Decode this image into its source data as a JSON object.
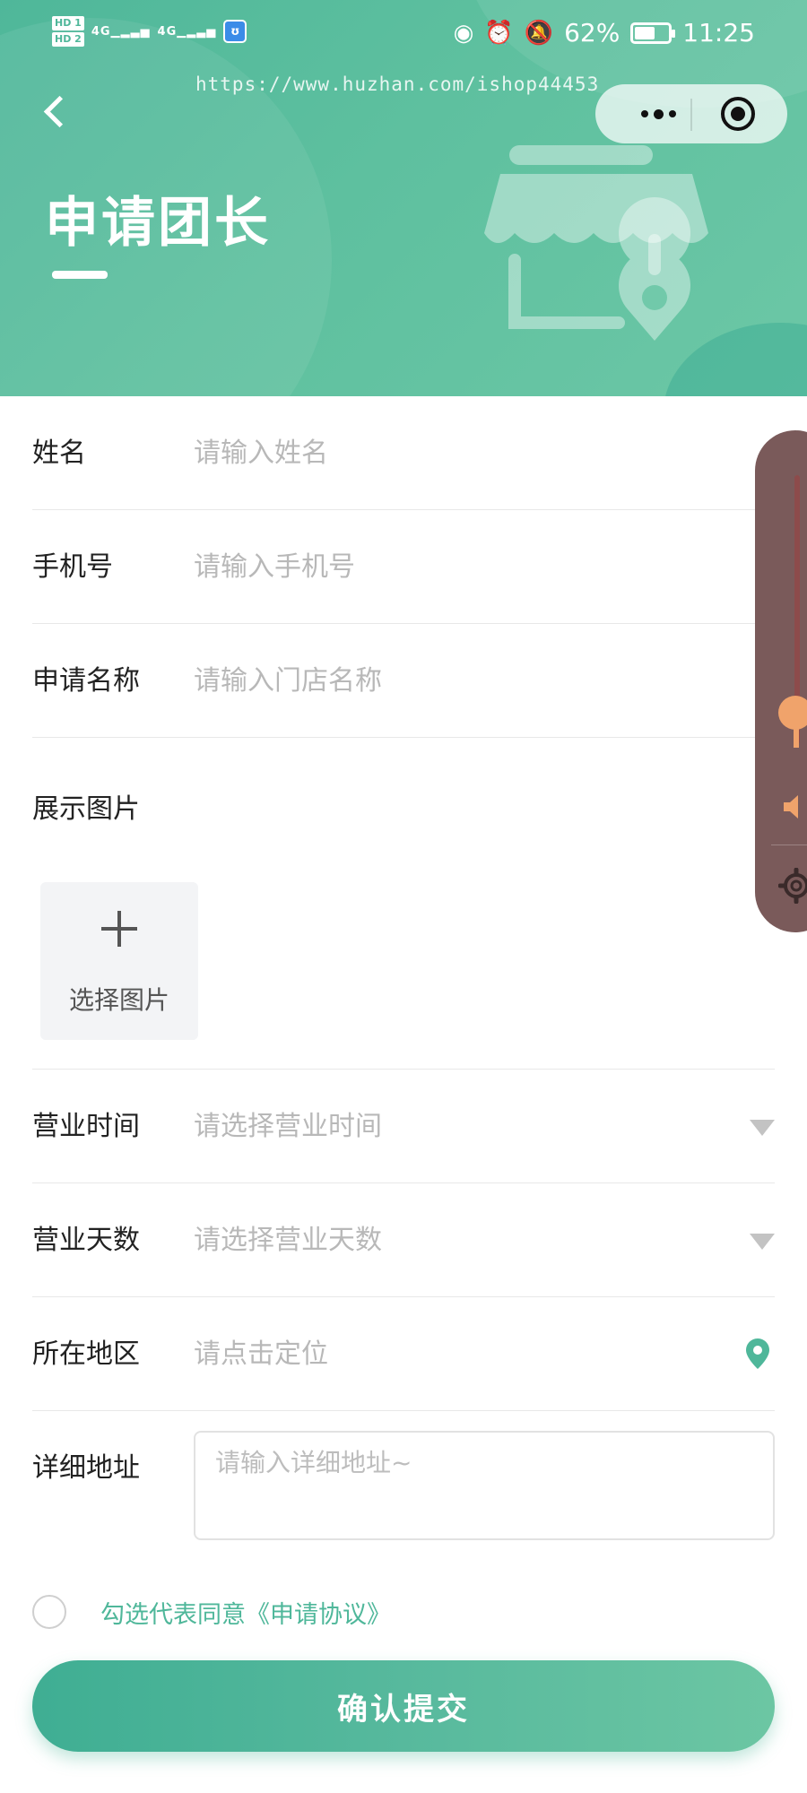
{
  "status_bar": {
    "hd1": "HD 1",
    "hd2": "HD 2",
    "network1": "4G",
    "network2": "4G",
    "app_badge": "ʊ",
    "battery_percent": "62%",
    "battery_level": 0.62,
    "time": "11:25"
  },
  "watermark": "https://www.huzhan.com/ishop44453",
  "header": {
    "title": "申请团长"
  },
  "form": {
    "name": {
      "label": "姓名",
      "placeholder": "请输入姓名"
    },
    "phone": {
      "label": "手机号",
      "placeholder": "请输入手机号"
    },
    "store_name": {
      "label": "申请名称",
      "placeholder": "请输入门店名称"
    },
    "photo": {
      "label": "展示图片",
      "upload_text": "选择图片"
    },
    "business_hours": {
      "label": "营业时间",
      "placeholder": "请选择营业时间"
    },
    "business_days": {
      "label": "营业天数",
      "placeholder": "请选择营业天数"
    },
    "region": {
      "label": "所在地区",
      "placeholder": "请点击定位"
    },
    "address": {
      "label": "详细地址",
      "placeholder": "请输入详细地址~"
    }
  },
  "agreement": {
    "text": "勾选代表同意《申请协议》",
    "checked": false
  },
  "submit": {
    "label": "确认提交"
  },
  "volume_panel": {
    "level": 0.5
  },
  "colors": {
    "accent": "#4fb79a",
    "placeholder": "#b8b8b8",
    "volume_panel": "#7a5a5a",
    "volume_knob": "#f0a36b"
  }
}
